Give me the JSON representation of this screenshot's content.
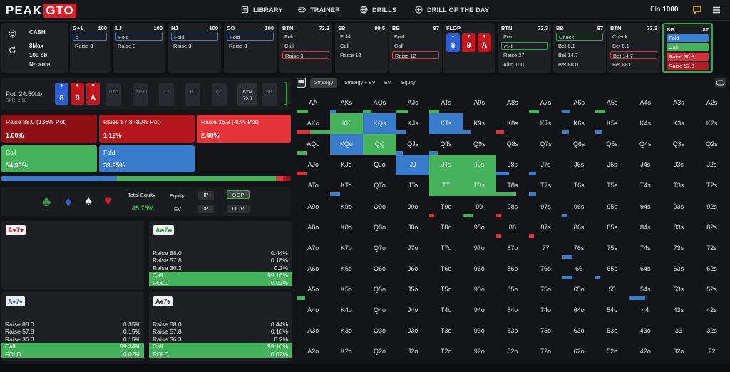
{
  "brand": {
    "part1": "PEAK",
    "part2": "GTO"
  },
  "nav": [
    {
      "label": "LIBRARY",
      "icon": "book-icon"
    },
    {
      "label": "TRAINER",
      "icon": "gamepad-icon"
    },
    {
      "label": "DRILLS",
      "icon": "globe-icon"
    },
    {
      "label": "DRILL OF THE DAY",
      "icon": "plus-circle-icon"
    }
  ],
  "elo": {
    "label": "Elo",
    "value": "1000"
  },
  "game": {
    "type": "CASH",
    "max": "8Max",
    "stack": "100 bb",
    "ante": "No ante"
  },
  "positions": [
    {
      "name": "G+1",
      "stack": "100",
      "actions": [
        {
          "t": "d",
          "s": "ob"
        },
        {
          "t": "Raise 3",
          "s": "n"
        }
      ]
    },
    {
      "name": "LJ",
      "stack": "100",
      "actions": [
        {
          "t": "Fold",
          "s": "ob"
        },
        {
          "t": "Raise 3",
          "s": "n"
        }
      ]
    },
    {
      "name": "HJ",
      "stack": "100",
      "actions": [
        {
          "t": "Fold",
          "s": "ob"
        },
        {
          "t": "Raise 3",
          "s": "n"
        }
      ]
    },
    {
      "name": "CO",
      "stack": "100",
      "actions": [
        {
          "t": "Fold",
          "s": "ob"
        },
        {
          "t": "Raise 3",
          "s": "n"
        }
      ]
    },
    {
      "name": "BTN",
      "stack": "73.3",
      "actions": [
        {
          "t": "Fold",
          "s": "n"
        },
        {
          "t": "Call",
          "s": "n"
        },
        {
          "t": "Raise 3",
          "s": "or"
        }
      ]
    },
    {
      "name": "SB",
      "stack": "99.5",
      "actions": [
        {
          "t": "Fold",
          "s": "n"
        },
        {
          "t": "Call",
          "s": "n"
        },
        {
          "t": "Raise 12",
          "s": "n"
        }
      ]
    },
    {
      "name": "BB",
      "stack": "87",
      "actions": [
        {
          "t": "Fold",
          "s": "n"
        },
        {
          "t": "Call",
          "s": "n"
        },
        {
          "t": "Raise 12",
          "s": "or"
        }
      ]
    },
    {
      "name": "BTN",
      "stack": "73.3",
      "actions": [
        {
          "t": "Fold",
          "s": "n"
        },
        {
          "t": "Call",
          "s": "og"
        },
        {
          "t": "Raise 27",
          "s": "n"
        },
        {
          "t": "Allin 100",
          "s": "n"
        }
      ]
    },
    {
      "name": "BB",
      "stack": "87",
      "actions": [
        {
          "t": "Check",
          "s": "og"
        },
        {
          "t": "Bet 6.1",
          "s": "n"
        },
        {
          "t": "Bet 14.7",
          "s": "n"
        },
        {
          "t": "Bet 88.0",
          "s": "n"
        }
      ]
    },
    {
      "name": "BTN",
      "stack": "73.3",
      "actions": [
        {
          "t": "Check",
          "s": "n"
        },
        {
          "t": "Bet 6.1",
          "s": "n"
        },
        {
          "t": "Bet 14.7",
          "s": "or"
        },
        {
          "t": "Bet 88.0",
          "s": "n"
        }
      ]
    },
    {
      "name": "BB",
      "stack": "87",
      "actions": [
        {
          "t": "Fold",
          "s": "fb"
        },
        {
          "t": "Call",
          "s": "fg"
        },
        {
          "t": "Raise 36.3",
          "s": "fr"
        },
        {
          "t": "Raise 57.8",
          "s": "fdr"
        }
      ]
    }
  ],
  "flop": {
    "label": "FLOP",
    "cards": [
      {
        "rank": "8",
        "suit": "♦",
        "color": "#2f5fd6"
      },
      {
        "rank": "9",
        "suit": "♥",
        "color": "#c4161e"
      },
      {
        "rank": "A",
        "suit": "♥",
        "color": "#c4161e"
      }
    ]
  },
  "hero_cards": [
    {
      "rank": "8",
      "suit": "♦",
      "color": "#2f5fd6"
    },
    {
      "rank": "9",
      "suit": "♥",
      "color": "#c4161e"
    },
    {
      "rank": "A",
      "suit": "♥",
      "color": "#c4161e"
    }
  ],
  "pot": {
    "label": "Pot",
    "value": "24.50bb",
    "spr": "SPR: 2.98"
  },
  "mini_positions": [
    {
      "n": "UTG",
      "s": ""
    },
    {
      "n": "UTG+1",
      "s": ""
    },
    {
      "n": "LJ",
      "s": ""
    },
    {
      "n": "HJ",
      "s": ""
    },
    {
      "n": "CO",
      "s": ""
    },
    {
      "n": "BTN",
      "s": "73.3"
    },
    {
      "n": "SB",
      "s": ""
    }
  ],
  "actions": [
    {
      "label": "Raise 88.0 (136% Pot)",
      "freq": "1.60%",
      "color": "#8e1015"
    },
    {
      "label": "Raise 57.8 (80% Pot)",
      "freq": "1.12%",
      "color": "#b3171d"
    },
    {
      "label": "Raise 36.3 (40% Pot)",
      "freq": "2.40%",
      "color": "#e5353b"
    },
    {
      "label": "Call",
      "freq": "54.93%",
      "color": "#46b25c"
    },
    {
      "label": "Fold",
      "freq": "39.95%",
      "color": "#3a7ccc"
    }
  ],
  "freqbar": [
    {
      "pct": 39.95,
      "color": "#3a7ccc"
    },
    {
      "pct": 54.93,
      "color": "#46b25c"
    },
    {
      "pct": 2.4,
      "color": "#e5353b"
    },
    {
      "pct": 1.12,
      "color": "#b3171d"
    },
    {
      "pct": 1.6,
      "color": "#8e1015"
    }
  ],
  "equity": {
    "total_label": "Total Equity",
    "total": "45.75%",
    "equity_label": "Equity",
    "ev_label": "EV",
    "ip": "IP",
    "oop": "OOP"
  },
  "combos": [
    {
      "card1": "A",
      "suit1": "♥",
      "c1": "#c4161e",
      "card2": "7",
      "suit2": "♥",
      "c2": "#c4161e",
      "rows": []
    },
    {
      "card1": "A",
      "suit1": "♣",
      "c1": "#2f9a45",
      "card2": "7",
      "suit2": "♣",
      "c2": "#2f9a45",
      "rows": [
        {
          "a": "Raise 88.0",
          "f": "0.44%"
        },
        {
          "a": "Raise 57.8",
          "f": "0.18%"
        },
        {
          "a": "Raise 36.3",
          "f": "0.2%"
        },
        {
          "a": "Call",
          "f": "99.16%",
          "g": true
        },
        {
          "a": "FOLD",
          "f": "0.02%",
          "g": true
        }
      ]
    },
    {
      "card1": "A",
      "suit1": "♦",
      "c1": "#2f5fd6",
      "card2": "7",
      "suit2": "♦",
      "c2": "#2f5fd6",
      "rows": [
        {
          "a": "Raise 88.0",
          "f": "0.35%"
        },
        {
          "a": "Raise 57.8",
          "f": "0.15%"
        },
        {
          "a": "Raise 36.3",
          "f": "0.15%"
        },
        {
          "a": "Call",
          "f": "99.34%",
          "g": true
        },
        {
          "a": "FOLD",
          "f": "0.02%",
          "g": true
        }
      ]
    },
    {
      "card1": "A",
      "suit1": "♠",
      "c1": "#222222",
      "card2": "7",
      "suit2": "♠",
      "c2": "#222222",
      "rows": [
        {
          "a": "Raise 88.0",
          "f": "0.44%"
        },
        {
          "a": "Raise 57.8",
          "f": "0.18%"
        },
        {
          "a": "Raise 36.3",
          "f": "0.2%"
        },
        {
          "a": "Call",
          "f": "99.16%",
          "g": true
        },
        {
          "a": "FOLD",
          "f": "0.02%",
          "g": true
        }
      ]
    }
  ],
  "tabs": [
    "Strategy",
    "Strategy + EV",
    "EV",
    "Equity"
  ],
  "ranks": [
    "A",
    "K",
    "Q",
    "J",
    "T",
    "9",
    "8",
    "7",
    "6",
    "5",
    "4",
    "3",
    "2"
  ],
  "cell_overrides": {
    "AA": [
      [
        "green",
        0.35
      ]
    ],
    "AKs": [
      [
        "blue",
        0.2
      ]
    ],
    "AQs": [
      [
        "green",
        0.25
      ]
    ],
    "AJs": [
      [
        "green",
        0.35
      ]
    ],
    "ATs": [
      [
        "green",
        0.3
      ]
    ],
    "A7s": [
      [
        "green",
        0.3
      ]
    ],
    "A6s": [
      [
        "blue",
        0.25
      ]
    ],
    "A5s": [
      [
        "green",
        0.3
      ]
    ],
    "AKo": [
      [
        "red",
        0.4
      ],
      [
        "green",
        0.6
      ]
    ],
    "KK": [
      [
        "green",
        1
      ]
    ],
    "KQs": [
      [
        "blue",
        1
      ]
    ],
    "KJs": [
      [
        "blue",
        0.3
      ]
    ],
    "KTs": [
      [
        "blue",
        1
      ]
    ],
    "K9s": [
      [
        "blue",
        0.25
      ]
    ],
    "K8s": [
      [
        "red",
        0.25
      ]
    ],
    "K6s": [
      [
        "blue",
        0.2
      ]
    ],
    "K5s": [
      [
        "blue",
        0.2
      ]
    ],
    "AQo": [
      [
        "green",
        0.3
      ]
    ],
    "KQo": [
      [
        "blue",
        1
      ]
    ],
    "QQ": [
      [
        "green",
        1
      ]
    ],
    "QJs": [
      [
        "blue",
        0.2
      ]
    ],
    "QTs": [
      [
        "blue",
        0.25
      ]
    ],
    "AJo": [
      [
        "red",
        0.3
      ]
    ],
    "JJ": [
      [
        "blue",
        1
      ]
    ],
    "JTs": [
      [
        "green",
        1
      ]
    ],
    "J9s": [
      [
        "green",
        1
      ]
    ],
    "J8s": [
      [
        "blue",
        0.4
      ]
    ],
    "J7s": [
      [
        "blue",
        0.2
      ]
    ],
    "KTo": [
      [
        "blue",
        0.3
      ]
    ],
    "TT": [
      [
        "green",
        1
      ]
    ],
    "T9s": [
      [
        "green",
        1
      ]
    ],
    "T8s": [
      [
        "green",
        0.6
      ]
    ],
    "T7s": [
      [
        "blue",
        0.2
      ]
    ],
    "T9o": [
      [
        "red",
        0.15
      ]
    ],
    "99": [
      [
        "green",
        0.3
      ]
    ],
    "98s": [
      [
        "red",
        0.15
      ]
    ],
    "96s": [
      [
        "blue",
        0.15
      ]
    ],
    "88": [
      [
        "red",
        0.15
      ]
    ],
    "87s": [
      [
        "red",
        0.15
      ]
    ],
    "76s": [
      [
        "blue",
        0.3
      ]
    ],
    "66": [
      [
        "blue",
        0.3
      ]
    ],
    "65s": [
      [
        "blue",
        0.15
      ]
    ],
    "A5o": [
      [
        "green",
        0.25
      ]
    ],
    "54s": [
      [
        "blue",
        0.5
      ]
    ]
  }
}
